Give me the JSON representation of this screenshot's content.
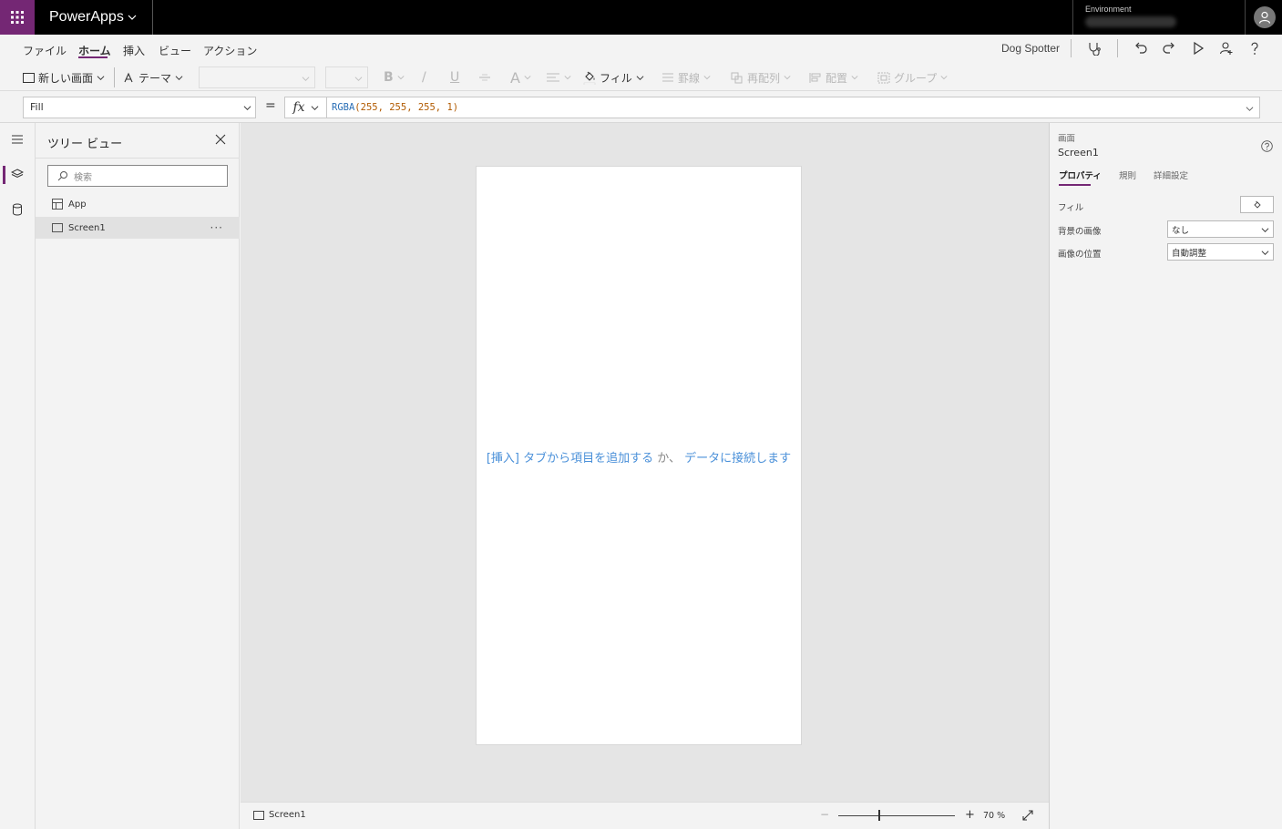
{
  "app": {
    "name": "PowerApps",
    "title": "Dog Spotter",
    "brand_color": "#742774"
  },
  "environment": {
    "label": "Environment"
  },
  "menu": {
    "tabs": [
      "ファイル",
      "ホーム",
      "挿入",
      "ビュー",
      "アクション"
    ],
    "active": "ホーム"
  },
  "ribbon": {
    "new_screen": "新しい画面",
    "theme": "テーマ",
    "fill": "フィル",
    "border": "罫線",
    "reorder": "再配列",
    "align": "配置",
    "group": "グループ",
    "bold": "B",
    "italic": "/",
    "underline": "U",
    "font_color": "A"
  },
  "formula_bar": {
    "property": "Fill",
    "equals": "=",
    "fx": "fx",
    "formula_fn": "RGBA",
    "formula_args": "(255, 255, 255, 1)"
  },
  "tree_view": {
    "title": "ツリー ビュー",
    "search_placeholder": "検索",
    "items": [
      {
        "label": "App",
        "icon": "app-icon"
      },
      {
        "label": "Screen1",
        "icon": "screen-icon",
        "selected": true
      }
    ],
    "more": "···"
  },
  "canvas": {
    "hint_link1": "[挿入] タブから項目を追加する",
    "hint_mid": "か、",
    "hint_link2": "データに接続します"
  },
  "statusbar": {
    "screen_name": "Screen1",
    "zoom_minus": "−",
    "zoom_plus": "+",
    "zoom_value": "70  %",
    "zoom_percent": 70
  },
  "properties": {
    "type": "画面",
    "name": "Screen1",
    "tabs": [
      "プロパティ",
      "規則",
      "詳細設定"
    ],
    "active_tab": "プロパティ",
    "fill_label": "フィル",
    "bg_image_label": "背景の画像",
    "bg_image_value": "なし",
    "image_position_label": "画像の位置",
    "image_position_value": "自動調整"
  }
}
